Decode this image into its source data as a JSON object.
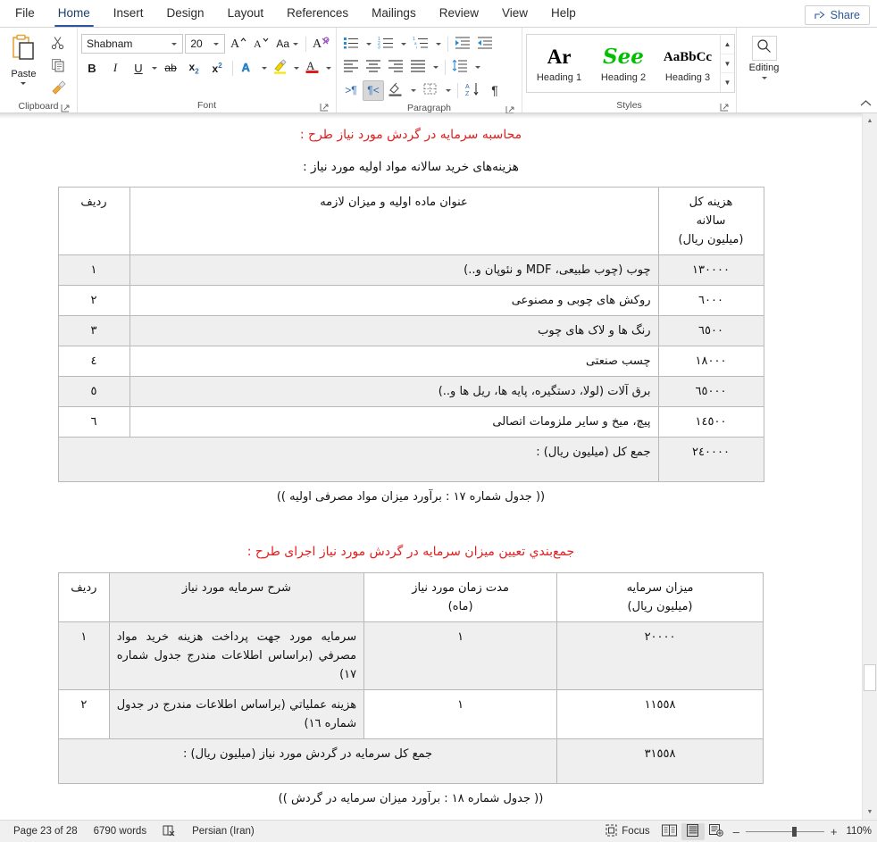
{
  "window": {
    "share_label": "Share"
  },
  "tabs": [
    {
      "label": "File",
      "active": false
    },
    {
      "label": "Home",
      "active": true
    },
    {
      "label": "Insert",
      "active": false
    },
    {
      "label": "Design",
      "active": false
    },
    {
      "label": "Layout",
      "active": false
    },
    {
      "label": "References",
      "active": false
    },
    {
      "label": "Mailings",
      "active": false
    },
    {
      "label": "Review",
      "active": false
    },
    {
      "label": "View",
      "active": false
    },
    {
      "label": "Help",
      "active": false
    }
  ],
  "ribbon": {
    "clipboard": {
      "group_label": "Clipboard",
      "paste_label": "Paste",
      "cut_icon": "scissors-icon",
      "copy_icon": "copy-icon",
      "format_painter_icon": "format-painter-icon"
    },
    "font": {
      "group_label": "Font",
      "font_name": "Shabnam",
      "font_size": "20",
      "grow_font_label": "A",
      "shrink_font_label": "A",
      "change_case_label": "Aa",
      "clear_format_label": "A",
      "bold_label": "B",
      "italic_label": "I",
      "underline_label": "U",
      "strikethrough_label": "ab",
      "subscript_label": "x",
      "superscript_label": "x",
      "text_effects_label": "A",
      "highlight_label": "A",
      "font_color_label": "A"
    },
    "paragraph": {
      "group_label": "Paragraph",
      "bullets_icon": "bullet-list-icon",
      "numbering_icon": "numbered-list-icon",
      "multilevel_icon": "multilevel-list-icon",
      "decrease_indent_icon": "decrease-indent-icon",
      "increase_indent_icon": "increase-indent-icon",
      "align_left_icon": "align-left-icon",
      "align_center_icon": "align-center-icon",
      "align_right_icon": "align-right-icon",
      "justify_icon": "justify-icon",
      "line_spacing_icon": "line-spacing-icon",
      "ltr_icon": "left-to-right-icon",
      "rtl_icon": "right-to-left-icon",
      "shading_icon": "shading-icon",
      "borders_icon": "borders-icon",
      "sort_icon": "sort-icon",
      "show_marks_label": "¶"
    },
    "styles": {
      "group_label": "Styles",
      "items": [
        {
          "preview": "Ar",
          "name": "Heading 1",
          "color": "#000000"
        },
        {
          "preview": "See",
          "name": "Heading 2",
          "color": "#00c000"
        },
        {
          "preview": "AaBbCc",
          "name": "Heading 3",
          "color": "#000000"
        }
      ]
    },
    "editing": {
      "group_label": "Editing",
      "label": "Editing",
      "icon": "search-icon"
    }
  },
  "document": {
    "heading1": "محاسبه سرمایه در گردش مورد نیاز طرح :",
    "lead1": "هزینه‌های خرید سالانه مواد اولیه مورد نیاز :",
    "table1": {
      "headers": [
        "هزینه کل سالانه (میلیون ریال)",
        "عنوان ماده اولیه و میزان لازمه",
        "ردیف"
      ],
      "header_cost_lines": [
        "هزینه کل",
        "سالانه",
        "(میلیون ریال)"
      ],
      "header_title": "عنوان ماده اولیه و میزان لازمه",
      "header_index": "ردیف",
      "rows": [
        {
          "cost": "١٣٠٠٠٠",
          "title": "چوب (چوب طبیعی، MDF و نئوپان و..)",
          "index": "١"
        },
        {
          "cost": "٦٠٠٠",
          "title": "روکش های چوبی و مصنوعی",
          "index": "٢"
        },
        {
          "cost": "٦٥٠٠",
          "title": "رنگ ها و لاک های چوب",
          "index": "٣"
        },
        {
          "cost": "١٨٠٠٠",
          "title": "چسب صنعتی",
          "index": "٤"
        },
        {
          "cost": "٦٥٠٠٠",
          "title": "برق آلات (لولا، دستگیره، پایه ها، ریل ها و..)",
          "index": "٥"
        },
        {
          "cost": "١٤٥٠٠",
          "title": "پیچ، میخ و سایر ملزومات اتصالی",
          "index": "٦"
        }
      ],
      "total_label": "جمع کل (میلیون ریال) :",
      "total_value": "٢٤٠٠٠٠"
    },
    "caption1": "(( جدول شماره ١٧ : برآورد میزان مواد مصرفی اولیه ))",
    "heading2": "جمع‌بندي تعیین میزان سرمایه در گردش مورد نیاز اجرای طرح :",
    "table2": {
      "header_amount_lines": [
        "میزان سرمایه",
        "(میلیون ریال)"
      ],
      "header_time_lines": [
        "مدت زمان مورد نیاز",
        "(ماه)"
      ],
      "header_desc": "شرح سرمایه مورد نیاز",
      "header_index": "ردیف",
      "rows": [
        {
          "amount": "٢٠٠٠٠",
          "time": "١",
          "desc": "سرمایه مورد جهت پرداخت هزینه خرید مواد مصرفي (براساس اطلاعات مندرج جدول شماره ١٧)",
          "index": "١"
        },
        {
          "amount": "١١٥٥٨",
          "time": "١",
          "desc": "هزینه عملیاتي (براساس اطلاعات مندرج در جدول شماره ١٦)",
          "index": "٢"
        }
      ],
      "total_label": "جمع کل سرمایه در گردش مورد نیاز (میلیون ریال) :",
      "total_value": "٣١٥٥٨"
    },
    "caption2": "(( جدول شماره ١٨ : برآورد میزان سرمایه در گردش ))"
  },
  "statusbar": {
    "page": "Page 23 of 28",
    "words": "6790 words",
    "proofing_icon": "proofing-errors-icon",
    "language": "Persian (Iran)",
    "focus_label": "Focus",
    "read_mode_icon": "read-mode-icon",
    "print_layout_icon": "print-layout-icon",
    "web_layout_icon": "web-layout-icon",
    "zoom_out_label": "–",
    "zoom_in_label": "+",
    "zoom_value": "110%"
  },
  "colors": {
    "accent": "#2b579a",
    "heading_red": "#e02020",
    "shade": "#efefef"
  }
}
